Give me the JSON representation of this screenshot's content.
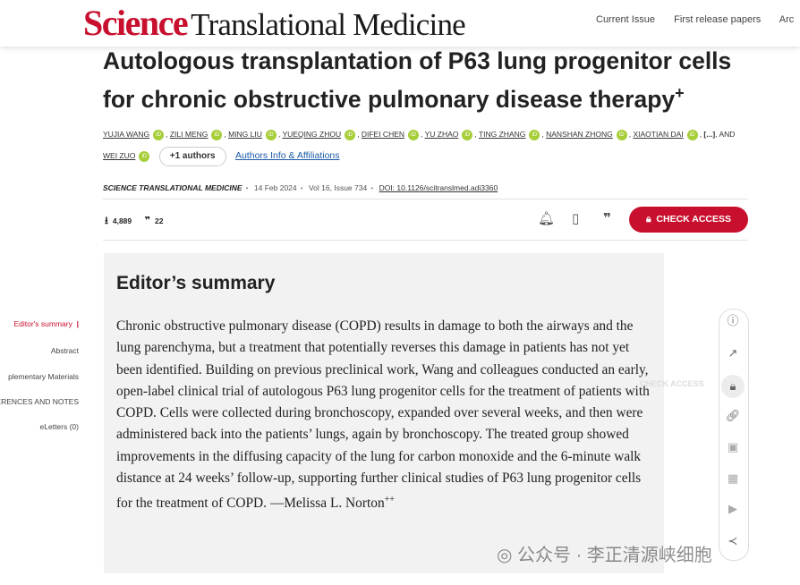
{
  "header": {
    "logo_science": "Science",
    "logo_rest": "Translational Medicine",
    "nav": [
      "Current Issue",
      "First release papers",
      "Arc"
    ]
  },
  "article": {
    "title": "Autologous transplantation of P63 lung progenitor cells for chronic obstructive pulmonary disease therapy",
    "title_mark": "+",
    "authors": [
      "YUJIA WANG",
      "ZILI MENG",
      "MING LIU",
      "YUEQING ZHOU",
      "DIFEI CHEN",
      "YU ZHAO",
      "TING ZHANG",
      "NANSHAN ZHONG",
      "XIAOTIAN DAI",
      "[...]",
      "AND",
      "WEI ZUO"
    ],
    "more_authors": "+1 authors",
    "affiliations": "Authors Info & Affiliations",
    "journal": "SCIENCE TRANSLATIONAL MEDICINE",
    "date": "14 Feb 2024",
    "volume": "Vol 16, Issue 734",
    "doi": "DOI: 10.1126/scitranslmed.adi3360",
    "downloads": "4,889",
    "citations": "22",
    "check_access": "CHECK ACCESS"
  },
  "left_nav": [
    "Editor's summary",
    "Abstract",
    "plementary Materials",
    "ERENCES AND NOTES",
    "eLetters (0)"
  ],
  "summary": {
    "heading": "Editor’s summary",
    "text": "Chronic obstructive pulmonary disease (COPD) results in damage to both the airways and the lung parenchyma, but a treatment that potentially reverses this damage in patients has not yet been identified. Building on previous preclinical work, Wang and colleagues conducted an early, open-label clinical trial of autologous P63 lung progenitor cells for the treatment of patients with COPD. Cells were collected during bronchoscopy, expanded over several weeks, and then were administered back into the patients’ lungs, again by bronchoscopy. The treated group showed improvements in the diffusing capacity of the lung for carbon monoxide and the 6-minute walk distance at 24 weeks’ follow-up, supporting further clinical studies of P63 lung progenitor cells for the treatment of COPD. —Melissa L. Norton",
    "signature_mark": "++"
  },
  "ghost_label": "CHECK ACCESS",
  "watermark": "公众号 · 李正清源峡细胞",
  "colors": {
    "brand_red": "#c8102e",
    "orcid_green": "#a6ce39",
    "summary_bg": "#f2f2f2",
    "link_blue": "#1a5aa6"
  }
}
